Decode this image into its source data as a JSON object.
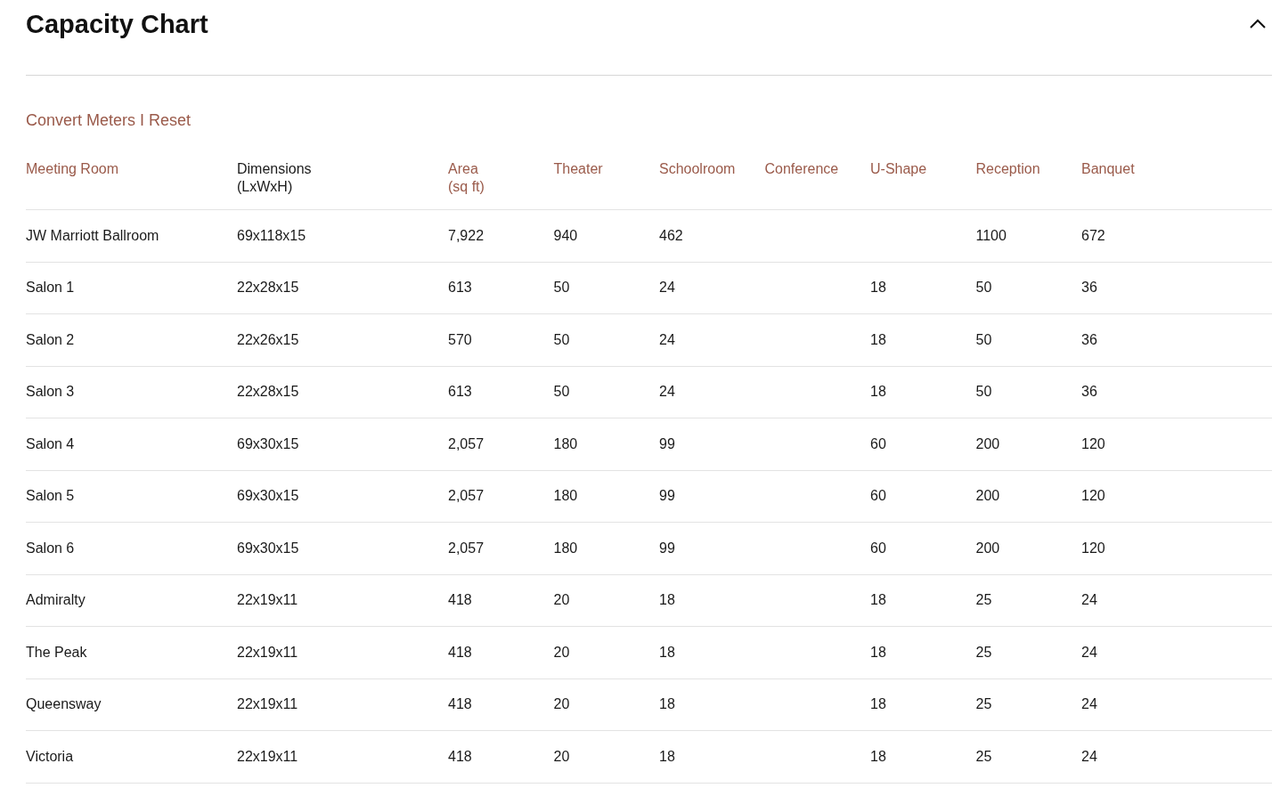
{
  "section": {
    "title": "Capacity Chart",
    "expanded": true
  },
  "unit_links": {
    "links": [
      "Convert Meters",
      "Reset"
    ],
    "separator": "I"
  },
  "table": {
    "columns": [
      {
        "label": "Meeting Room",
        "sortable": true
      },
      {
        "label": "Dimensions",
        "sublabel": "(LxWxH)",
        "sortable": false
      },
      {
        "label": "Area",
        "sublabel": "(sq ft)",
        "sortable": true
      },
      {
        "label": "Theater",
        "sortable": true
      },
      {
        "label": "Schoolroom",
        "sortable": true
      },
      {
        "label": "Conference",
        "sortable": true
      },
      {
        "label": "U-Shape",
        "sortable": true
      },
      {
        "label": "Reception",
        "sortable": true
      },
      {
        "label": "Banquet",
        "sortable": true
      }
    ],
    "rows": [
      [
        "JW Marriott Ballroom",
        "69x118x15",
        "7,922",
        "940",
        "462",
        null,
        null,
        "1100",
        "672"
      ],
      [
        "Salon 1",
        "22x28x15",
        "613",
        "50",
        "24",
        null,
        "18",
        "50",
        "36"
      ],
      [
        "Salon 2",
        "22x26x15",
        "570",
        "50",
        "24",
        null,
        "18",
        "50",
        "36"
      ],
      [
        "Salon 3",
        "22x28x15",
        "613",
        "50",
        "24",
        null,
        "18",
        "50",
        "36"
      ],
      [
        "Salon 4",
        "69x30x15",
        "2,057",
        "180",
        "99",
        null,
        "60",
        "200",
        "120"
      ],
      [
        "Salon 5",
        "69x30x15",
        "2,057",
        "180",
        "99",
        null,
        "60",
        "200",
        "120"
      ],
      [
        "Salon 6",
        "69x30x15",
        "2,057",
        "180",
        "99",
        null,
        "60",
        "200",
        "120"
      ],
      [
        "Admiralty",
        "22x19x11",
        "418",
        "20",
        "18",
        null,
        "18",
        "25",
        "24"
      ],
      [
        "The Peak",
        "22x19x11",
        "418",
        "20",
        "18",
        null,
        "18",
        "25",
        "24"
      ],
      [
        "Queensway",
        "22x19x11",
        "418",
        "20",
        "18",
        null,
        "18",
        "25",
        "24"
      ],
      [
        "Victoria",
        "22x19x11",
        "418",
        "20",
        "18",
        null,
        "18",
        "25",
        "24"
      ]
    ]
  }
}
